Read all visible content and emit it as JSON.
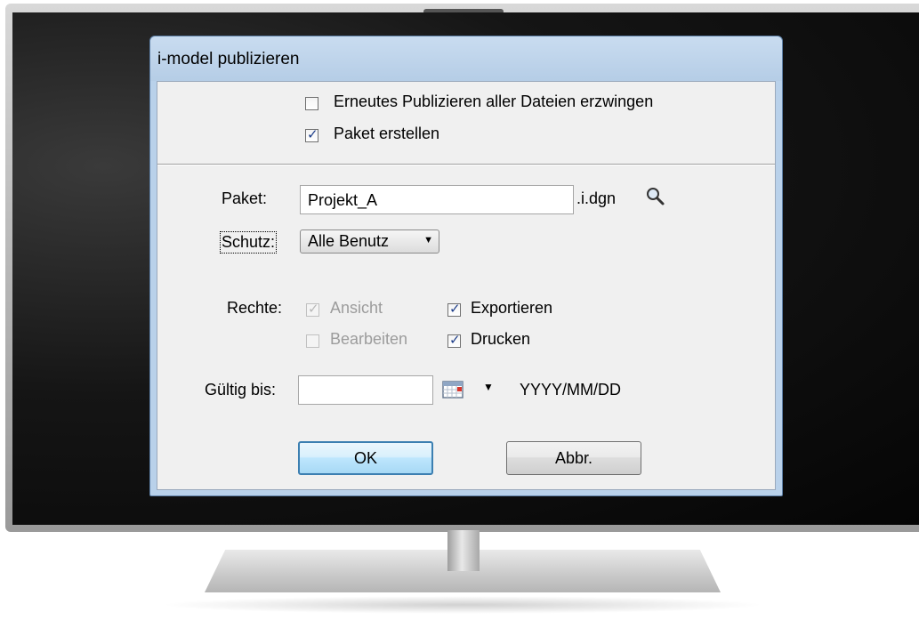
{
  "dialog": {
    "title": "i-model publizieren"
  },
  "options": {
    "force_republish_label": "Erneutes Publizieren aller Dateien erzwingen",
    "force_republish_checked": false,
    "create_package_label": "Paket erstellen",
    "create_package_checked": true
  },
  "package": {
    "label": "Paket:",
    "value": "Projekt_A",
    "suffix": ".i.dgn",
    "browse_icon": "magnifier-icon"
  },
  "protection": {
    "label": "Schutz:",
    "selected": "Alle Benutz"
  },
  "rights": {
    "label": "Rechte:",
    "view_label": "Ansicht",
    "view_checked": true,
    "view_enabled": false,
    "edit_label": "Bearbeiten",
    "edit_checked": false,
    "edit_enabled": false,
    "export_label": "Exportieren",
    "export_checked": true,
    "print_label": "Drucken",
    "print_checked": true
  },
  "valid_until": {
    "label": "Gültig bis:",
    "value": "",
    "calendar_icon": "calendar-icon",
    "format_hint": "YYYY/MM/DD"
  },
  "buttons": {
    "ok_label": "OK",
    "cancel_label": "Abbr."
  },
  "colors": {
    "dialog_frame": "#b9d1ea",
    "client_bg": "#f0f0f0",
    "check_color": "#1f3f8a"
  }
}
